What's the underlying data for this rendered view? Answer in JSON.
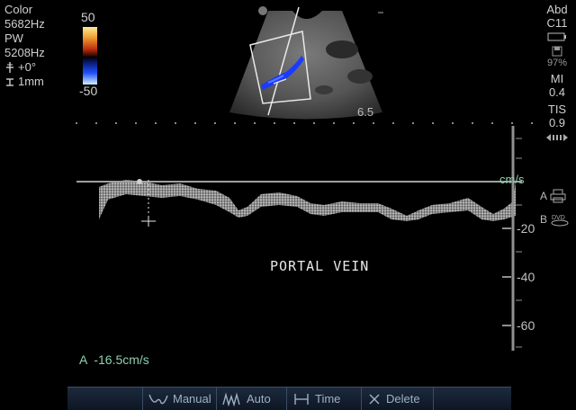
{
  "left_params": {
    "lines": [
      "Color",
      "5682Hz",
      "PW",
      "5208Hz"
    ],
    "angle": "+0°",
    "gate": "1mm"
  },
  "color_scale": {
    "top": "50",
    "bottom": "-50"
  },
  "right_params": {
    "preset": "Abd",
    "probe": "C11",
    "battery": "97%",
    "mi_label": "MI",
    "mi_value": "0.4",
    "tis_label": "TIS",
    "tis_value": "0.9",
    "printer_a": "A",
    "printer_b": "B"
  },
  "depth_label": "6.5",
  "spectral": {
    "unit": "cm/s",
    "ticks": [
      "-20",
      "-40",
      "-60"
    ]
  },
  "annotation": "PORTAL VEIN",
  "measurement": "A  -16.5cm/s",
  "toolbar": {
    "manual": "Manual",
    "auto": "Auto",
    "time": "Time",
    "delete": "Delete"
  },
  "icons": {
    "angle": "angle-correct-icon",
    "gate": "gate-size-icon",
    "battery": "battery-icon",
    "save": "save-icon",
    "cine": "cine-arrows-icon",
    "printer": "printer-icon",
    "dvd": "dvd-icon",
    "manual": "manual-trace-icon",
    "auto": "auto-trace-icon",
    "time": "time-measure-icon",
    "delete": "delete-icon"
  }
}
